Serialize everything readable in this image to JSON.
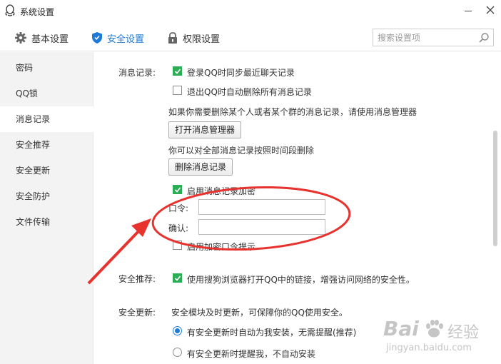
{
  "window": {
    "title": "系统设置"
  },
  "toolbar": {
    "tabs": [
      {
        "label": "基本设置",
        "icon": "gear-icon",
        "active": false
      },
      {
        "label": "安全设置",
        "icon": "shield-icon",
        "active": true
      },
      {
        "label": "权限设置",
        "icon": "lock-icon",
        "active": false
      }
    ],
    "search_placeholder": "搜索设置项"
  },
  "sidebar": {
    "items": [
      {
        "label": "密码"
      },
      {
        "label": "QQ锁"
      },
      {
        "label": "消息记录",
        "active": true
      },
      {
        "label": "安全推荐"
      },
      {
        "label": "安全更新"
      },
      {
        "label": "安全防护"
      },
      {
        "label": "文件传输"
      }
    ]
  },
  "message_records": {
    "section_label": "消息记录:",
    "sync_label": "登录QQ时同步最近聊天记录",
    "sync_checked": true,
    "delete_on_exit_label": "退出QQ时自动删除所有消息记录",
    "delete_on_exit_checked": false,
    "manager_hint": "如果你需要删除某个人或者某个群的消息记录，请使用消息管理器",
    "open_manager_button": "打开消息管理器",
    "delete_hint": "你可以对全部消息记录按照时间段删除",
    "delete_button": "删除消息记录",
    "encrypt_label": "启用消息记录加密",
    "encrypt_checked": true,
    "password_label": "口令:",
    "password_value": "",
    "confirm_label": "确认:",
    "confirm_value": "",
    "hint_label": "启用加密口令提示",
    "hint_checked": false
  },
  "security_recommend": {
    "section_label": "安全推荐:",
    "sogou_label": "使用搜狗浏览器打开QQ中的链接，增强访问网络的安全性。",
    "sogou_checked": true
  },
  "security_update": {
    "section_label": "安全更新:",
    "description": "安全模块及时更新，可保障你的QQ使用安全。",
    "options": [
      {
        "label": "有安全更新时自动为我安装，无需提醒(推荐)",
        "selected": true
      },
      {
        "label": "有安全更新时提醒我，不自动安装",
        "selected": false
      }
    ]
  },
  "watermark": {
    "logo_text": "Bai",
    "logo_cn": "经验",
    "url": "jingyan.baidu.com"
  },
  "colors": {
    "accent": "#1e7ad6",
    "check_green": "#2bad55",
    "annotation_red": "#e8322d"
  }
}
